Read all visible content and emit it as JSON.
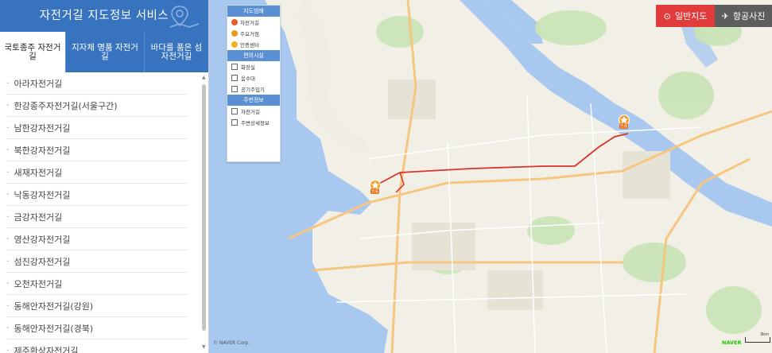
{
  "sidebar": {
    "title": "자전거길 지도정보 서비스",
    "tabs": [
      "국토종주 자전거길",
      "지자체 명품 자전거길",
      "바다를 품은 섬 자전거길"
    ],
    "items": [
      "아라자전거길",
      "한강종주자전거길(서울구간)",
      "남한강자전거길",
      "북한강자전거길",
      "새재자전거길",
      "낙동강자전거길",
      "금강자전거길",
      "영산강자전거길",
      "섬진강자전거길",
      "오천자전거길",
      "동해안자전거길(강원)",
      "동해안자전거길(경북)",
      "제주환상자전거길"
    ]
  },
  "legend": {
    "header_map": "지도범례",
    "map_items": [
      "자전거길",
      "주요거점",
      "인증센터"
    ],
    "header_facility": "편의시설",
    "facility_items": [
      "화장실",
      "음수대",
      "공기주입기"
    ],
    "header_info": "주변정보",
    "info_items": [
      "자전거길",
      "주변상세정보"
    ]
  },
  "map_buttons": {
    "normal": "일반지도",
    "aerial": "항공사진"
  },
  "markers": [
    "인증",
    "인증"
  ],
  "attribution": "© NAVER Corp.",
  "naver_logo": "NAVER",
  "scale_label": "3km",
  "colors": {
    "header_blue": "#3773bf",
    "route_red": "#d9342b",
    "river": "#a9c8ef",
    "button_red": "#e23b3b"
  }
}
